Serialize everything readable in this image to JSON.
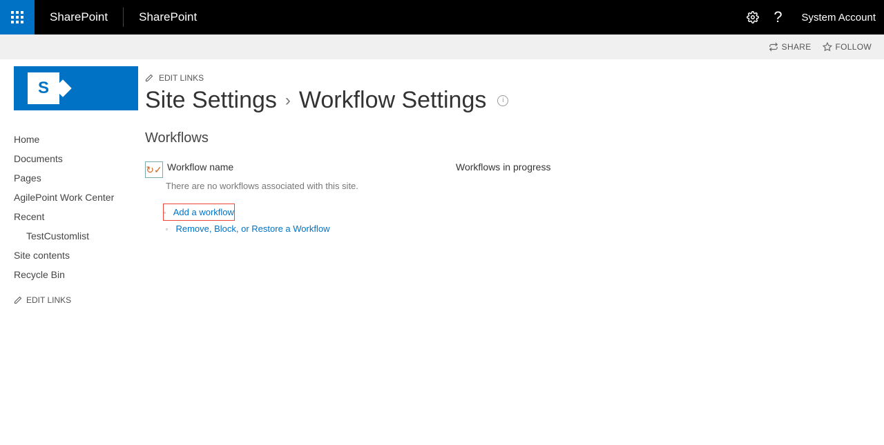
{
  "topbar": {
    "brand1": "SharePoint",
    "brand2": "SharePoint",
    "account": "System Account"
  },
  "actionbar": {
    "share": "SHARE",
    "follow": "FOLLOW"
  },
  "nav": {
    "items": [
      {
        "label": "Home",
        "indent": false
      },
      {
        "label": "Documents",
        "indent": false
      },
      {
        "label": "Pages",
        "indent": false
      },
      {
        "label": "AgilePoint Work Center",
        "indent": false
      },
      {
        "label": "Recent",
        "indent": false
      },
      {
        "label": "TestCustomlist",
        "indent": true
      },
      {
        "label": "Site contents",
        "indent": false
      },
      {
        "label": "Recycle Bin",
        "indent": false
      }
    ],
    "edit_links": "EDIT LINKS"
  },
  "content": {
    "edit_links": "EDIT LINKS",
    "title_part1": "Site Settings",
    "title_part2": "Workflow Settings",
    "section_title": "Workflows",
    "wf_name_header": "Workflow name",
    "wf_empty_msg": "There are no workflows associated with this site.",
    "wf_progress_header": "Workflows in progress",
    "links": {
      "add": "Add a workflow",
      "remove": "Remove, Block, or Restore a Workflow"
    }
  }
}
